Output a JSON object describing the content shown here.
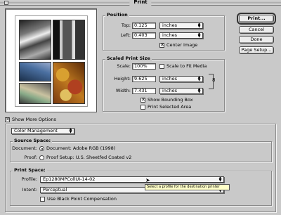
{
  "window": {
    "title": "Print"
  },
  "position": {
    "title": "Position",
    "top_label": "Top:",
    "top_value": "0.125",
    "top_unit": "inches",
    "left_label": "Left:",
    "left_value": "0.403",
    "left_unit": "inches",
    "center_image_label": "Center Image",
    "center_image_checked": true
  },
  "scaled": {
    "title": "Scaled Print Size",
    "scale_label": "Scale:",
    "scale_value": "100%",
    "fit_media_label": "Scale to Fit Media",
    "fit_media_checked": false,
    "height_label": "Height:",
    "height_value": "9.625",
    "height_unit": "inches",
    "width_label": "Width:",
    "width_value": "7.431",
    "width_unit": "inches",
    "bounding_label": "Show Bounding Box",
    "bounding_checked": true,
    "selected_area_label": "Print Selected Area",
    "selected_area_checked": false
  },
  "buttons": {
    "print": "Print...",
    "cancel": "Cancel",
    "done": "Done",
    "page_setup": "Page Setup..."
  },
  "more_options": {
    "label": "Show More Options",
    "checked": true
  },
  "color_mgmt": {
    "selected": "Color Management"
  },
  "source": {
    "title": "Source Space:",
    "document_label": "Document:",
    "document_option": "Document: Adobe RGB (1998)",
    "document_selected": true,
    "proof_label": "Proof:",
    "proof_option": "Proof Setup: U.S. Sheetfed Coated v2",
    "proof_selected": false
  },
  "print_space": {
    "title": "Print Space:",
    "profile_label": "Profile:",
    "profile_value": "Ep1280MPCollUI-14-02",
    "intent_label": "Intent:",
    "intent_value": "Perceptual",
    "bpc_label": "Use Black Point Compensation",
    "bpc_checked": false
  },
  "tooltip": {
    "text": "Select a profile for the destination printer"
  },
  "icons": {
    "close": "close-box-icon",
    "link": "link-chain-icon",
    "popup": "popup-arrows-icon",
    "cursor": "arrow-cursor-icon"
  }
}
